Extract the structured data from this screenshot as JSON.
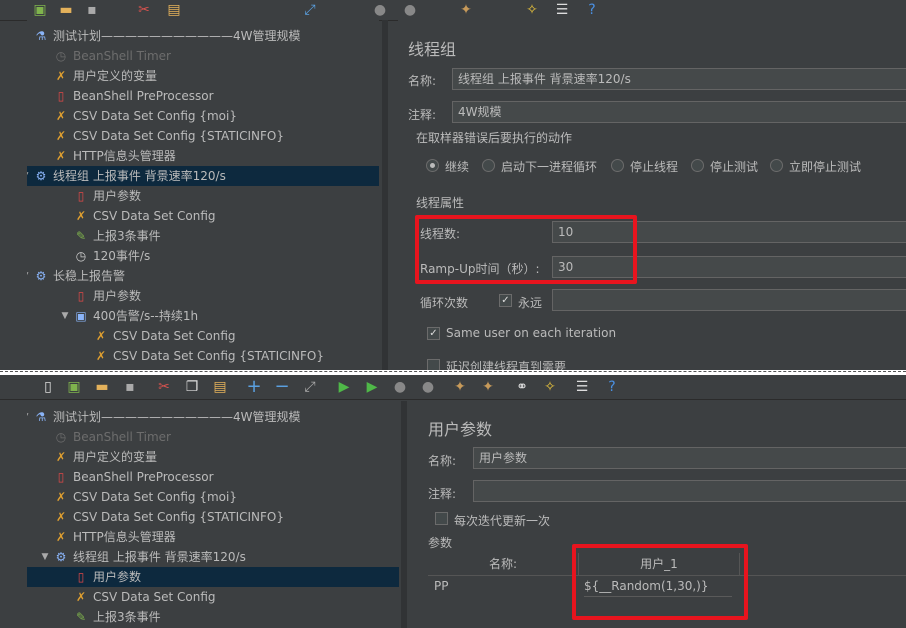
{
  "top": {
    "tree": [
      {
        "label": "测试计划",
        "suffix": "———————————4W管理规模",
        "icon": "flask-icon",
        "level": 0,
        "arrow": "",
        "disabled": false
      },
      {
        "label": "BeanShell Timer",
        "icon": "timer-icon",
        "level": 1,
        "disabled": true
      },
      {
        "label": "用户定义的变量",
        "icon": "wrench-icon",
        "level": 1
      },
      {
        "label": "BeanShell PreProcessor",
        "icon": "preprocessor-icon",
        "level": 1
      },
      {
        "label": "CSV Data Set Config {moi}",
        "icon": "wrench-icon",
        "level": 1
      },
      {
        "label": "CSV Data Set Config {STATICINFO}",
        "icon": "wrench-icon",
        "level": 1
      },
      {
        "label": "HTTP信息头管理器",
        "icon": "wrench-icon",
        "level": 1
      },
      {
        "label": "线程组 上报事件 背景速率120/s",
        "icon": "gear-icon",
        "level": 0,
        "arrow": "▼",
        "selected": true
      },
      {
        "label": "用户参数",
        "icon": "preprocessor-icon",
        "level": 2
      },
      {
        "label": "CSV Data Set Config",
        "icon": "wrench-icon",
        "level": 2
      },
      {
        "label": "上报3条事件",
        "icon": "pencil-icon",
        "level": 2
      },
      {
        "label": "120事件/s",
        "icon": "timer-icon",
        "level": 2
      },
      {
        "label": "长稳上报告警",
        "icon": "gear-icon",
        "level": 0,
        "arrow": "▼"
      },
      {
        "label": "用户参数",
        "icon": "preprocessor-icon",
        "level": 2
      },
      {
        "label": "400告警/s--持续1h",
        "icon": "loop-icon",
        "level": 2,
        "arrow": "▼"
      },
      {
        "label": "CSV Data Set Config",
        "icon": "wrench-icon",
        "level": 3
      },
      {
        "label": "CSV Data Set Config {STATICINFO}",
        "icon": "wrench-icon",
        "level": 3
      }
    ],
    "panel": {
      "title": "线程组",
      "name_label": "名称:",
      "name_value": "线程组 上报事件 背景速率120/s",
      "comment_label": "注释:",
      "comment_value": "4W规模",
      "error_section": "在取样器错误后要执行的动作",
      "error_options": [
        "继续",
        "启动下一进程循环",
        "停止线程",
        "停止测试",
        "立即停止测试"
      ],
      "error_selected": 0,
      "thread_section": "线程属性",
      "threads_label": "线程数:",
      "threads_value": "10",
      "rampup_label": "Ramp-Up时间（秒）:",
      "rampup_value": "30",
      "loop_label": "循环次数",
      "loop_forever_label": "永远",
      "same_user_label": "Same user on each iteration",
      "delay_label": "延迟创建线程直到需要"
    }
  },
  "bottom": {
    "tree": [
      {
        "label": "测试计划",
        "suffix": "———————————4W管理规模",
        "icon": "flask-icon",
        "level": 0,
        "arrow": "▼"
      },
      {
        "label": "BeanShell Timer",
        "icon": "timer-icon",
        "level": 1,
        "disabled": true
      },
      {
        "label": "用户定义的变量",
        "icon": "wrench-icon",
        "level": 1
      },
      {
        "label": "BeanShell PreProcessor",
        "icon": "preprocessor-icon",
        "level": 1
      },
      {
        "label": "CSV Data Set Config {moi}",
        "icon": "wrench-icon",
        "level": 1
      },
      {
        "label": "CSV Data Set Config {STATICINFO}",
        "icon": "wrench-icon",
        "level": 1
      },
      {
        "label": "HTTP信息头管理器",
        "icon": "wrench-icon",
        "level": 1
      },
      {
        "label": "线程组 上报事件 背景速率120/s",
        "icon": "gear-icon",
        "level": 1,
        "arrow": "▼"
      },
      {
        "label": "用户参数",
        "icon": "preprocessor-icon",
        "level": 2,
        "selected": true
      },
      {
        "label": "CSV Data Set Config",
        "icon": "wrench-icon",
        "level": 2
      },
      {
        "label": "上报3条事件",
        "icon": "pencil-icon",
        "level": 2
      }
    ],
    "panel": {
      "title": "用户参数",
      "name_label": "名称:",
      "name_value": "用户参数",
      "comment_label": "注释:",
      "comment_value": "",
      "update_label": "每次迭代更新一次",
      "params_label": "参数",
      "col_name": "名称:",
      "col_user": "用户_1",
      "rows": [
        {
          "name": "PP",
          "value": "${__Random(1,30,)}"
        }
      ]
    }
  },
  "colors": {
    "accent_red": "#e8141e",
    "selected_row": "#0d293e",
    "panel_bg": "#3c3f41"
  }
}
